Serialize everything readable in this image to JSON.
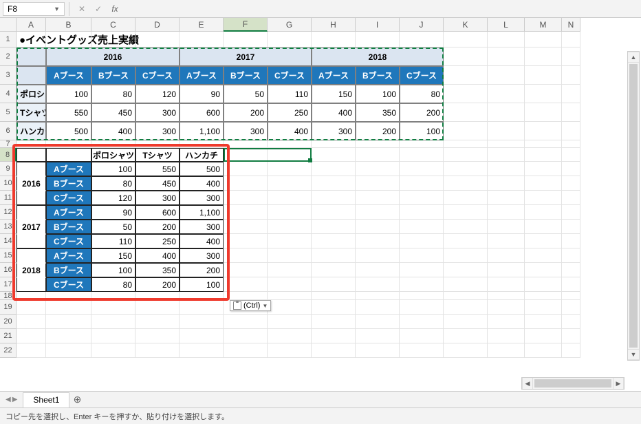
{
  "namebox": "F8",
  "sheet": "Sheet1",
  "status": "コピー先を選択し、Enter キーを押すか、貼り付けを選択します。",
  "paste_label": "(Ctrl)",
  "columns": [
    "A",
    "B",
    "C",
    "D",
    "E",
    "F",
    "G",
    "H",
    "I",
    "J",
    "K",
    "L",
    "M",
    "N"
  ],
  "rows": [
    "1",
    "2",
    "3",
    "4",
    "5",
    "6",
    "7",
    "8",
    "9",
    "10",
    "11",
    "12",
    "13",
    "14",
    "15",
    "16",
    "17",
    "18",
    "19",
    "20",
    "21",
    "22"
  ],
  "title": "●イベントグッズ売上実績",
  "table1": {
    "years": [
      "2016",
      "2017",
      "2018"
    ],
    "booths": [
      "Aブース",
      "Bブース",
      "Cブース"
    ],
    "items": [
      "ポロシャツ",
      "Tシャツ",
      "ハンカチ"
    ],
    "data": [
      [
        "100",
        "80",
        "120",
        "90",
        "50",
        "110",
        "150",
        "100",
        "80"
      ],
      [
        "550",
        "450",
        "300",
        "600",
        "200",
        "250",
        "400",
        "350",
        "200"
      ],
      [
        "500",
        "400",
        "300",
        "1,100",
        "300",
        "400",
        "300",
        "200",
        "100"
      ]
    ]
  },
  "table2": {
    "headers": [
      "ポロシャツ",
      "Tシャツ",
      "ハンカチ"
    ],
    "groups": [
      {
        "year": "2016",
        "booths": [
          "Aブース",
          "Bブース",
          "Cブース"
        ],
        "vals": [
          [
            "100",
            "550",
            "500"
          ],
          [
            "80",
            "450",
            "400"
          ],
          [
            "120",
            "300",
            "300"
          ]
        ]
      },
      {
        "year": "2017",
        "booths": [
          "Aブース",
          "Bブース",
          "Cブース"
        ],
        "vals": [
          [
            "90",
            "600",
            "1,100"
          ],
          [
            "50",
            "200",
            "300"
          ],
          [
            "110",
            "250",
            "400"
          ]
        ]
      },
      {
        "year": "2018",
        "booths": [
          "Aブース",
          "Bブース",
          "Cブース"
        ],
        "vals": [
          [
            "150",
            "400",
            "300"
          ],
          [
            "100",
            "350",
            "200"
          ],
          [
            "80",
            "200",
            "100"
          ]
        ]
      }
    ]
  }
}
